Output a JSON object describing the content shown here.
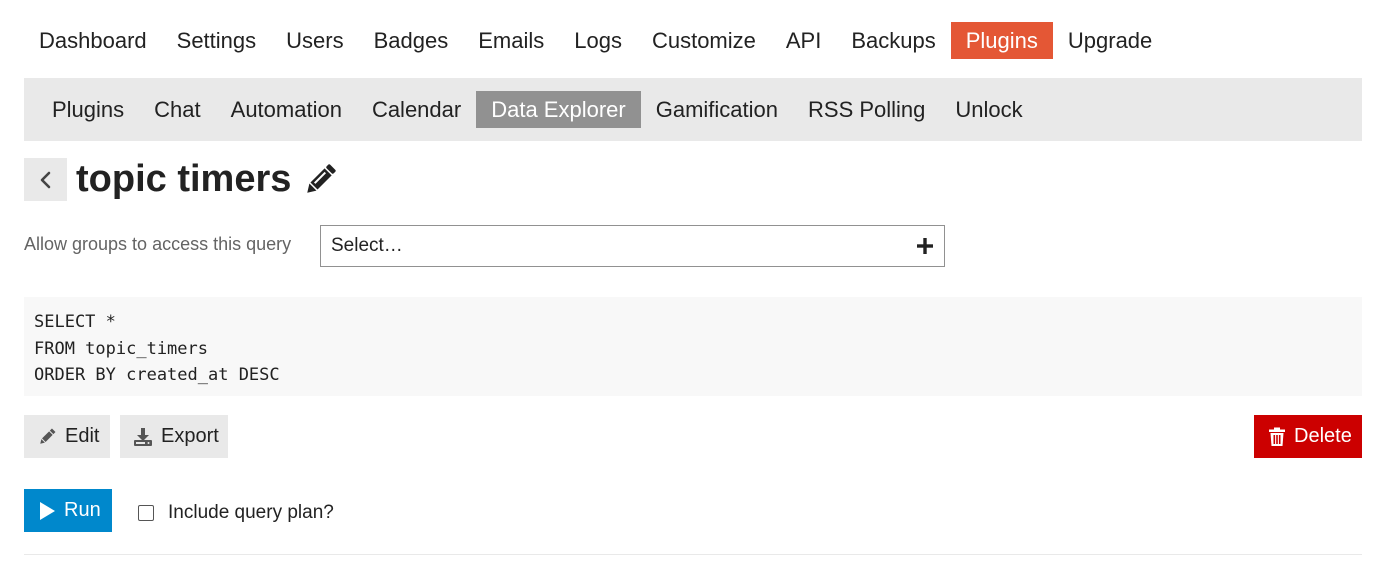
{
  "top_nav": {
    "items": [
      {
        "label": "Dashboard"
      },
      {
        "label": "Settings"
      },
      {
        "label": "Users"
      },
      {
        "label": "Badges"
      },
      {
        "label": "Emails"
      },
      {
        "label": "Logs"
      },
      {
        "label": "Customize"
      },
      {
        "label": "API"
      },
      {
        "label": "Backups"
      },
      {
        "label": "Plugins",
        "active": true
      },
      {
        "label": "Upgrade"
      }
    ]
  },
  "sub_nav": {
    "items": [
      {
        "label": "Plugins"
      },
      {
        "label": "Chat"
      },
      {
        "label": "Automation"
      },
      {
        "label": "Calendar"
      },
      {
        "label": "Data Explorer",
        "active": true
      },
      {
        "label": "Gamification"
      },
      {
        "label": "RSS Polling"
      },
      {
        "label": "Unlock"
      }
    ]
  },
  "query": {
    "title": "topic timers",
    "groups_label": "Allow groups to access this query",
    "groups_placeholder": "Select…",
    "sql_lines": [
      "SELECT *",
      "FROM topic_timers",
      "ORDER BY created_at DESC"
    ]
  },
  "actions": {
    "edit_label": "Edit",
    "export_label": "Export",
    "delete_label": "Delete",
    "run_label": "Run",
    "include_plan_label": "Include query plan?",
    "include_plan_checked": false
  },
  "colors": {
    "brand_accent": "#e45735",
    "danger": "#cc0000",
    "primary": "#0088cc",
    "subnav_active": "#919191"
  },
  "icons": {
    "back": "chevron-left-icon",
    "title_edit": "pencil-icon",
    "add": "plus-icon",
    "edit": "pencil-icon",
    "export": "download-icon",
    "delete": "trash-icon",
    "run": "play-icon"
  }
}
